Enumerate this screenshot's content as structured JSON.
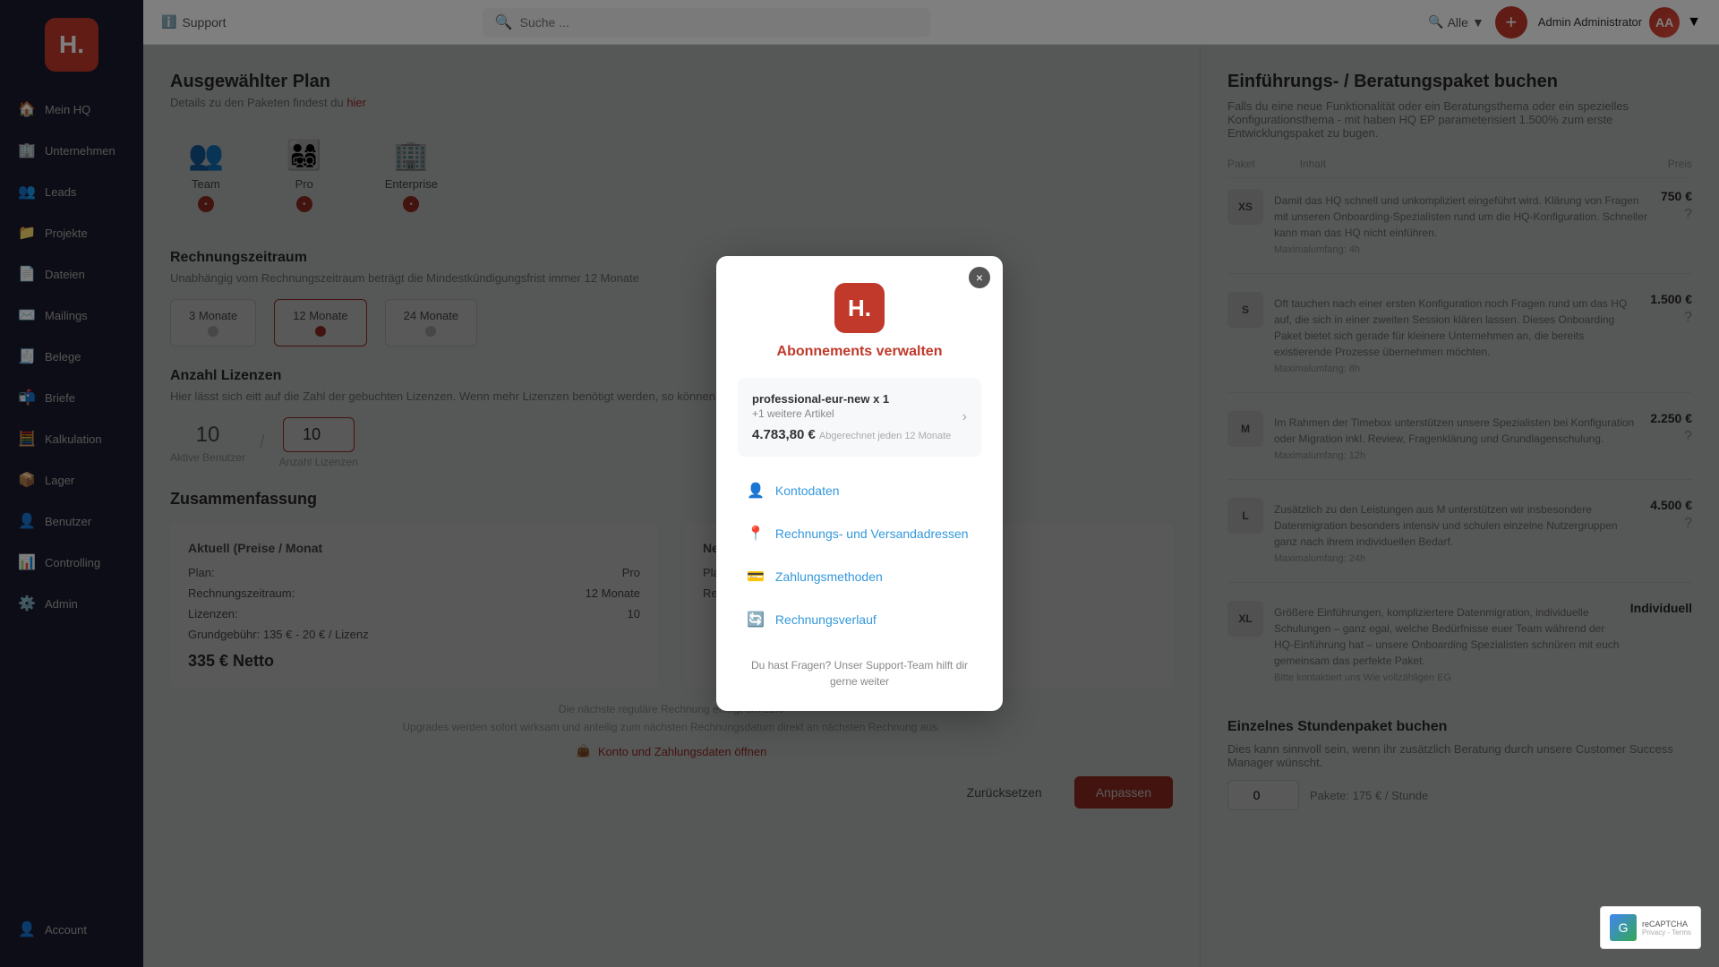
{
  "sidebar": {
    "logo_text": "H.",
    "items": [
      {
        "id": "mein-hq",
        "label": "Mein HQ",
        "icon": "🏠"
      },
      {
        "id": "unternehmen",
        "label": "Unternehmen",
        "icon": "🏢"
      },
      {
        "id": "leads",
        "label": "Leads",
        "icon": "👥"
      },
      {
        "id": "projekte",
        "label": "Projekte",
        "icon": "📁"
      },
      {
        "id": "dateien",
        "label": "Dateien",
        "icon": "📄"
      },
      {
        "id": "mailings",
        "label": "Mailings",
        "icon": "✉️"
      },
      {
        "id": "belege",
        "label": "Belege",
        "icon": "🧾"
      },
      {
        "id": "briefe",
        "label": "Briefe",
        "icon": "📬"
      },
      {
        "id": "kalkulation",
        "label": "Kalkulation",
        "icon": "🧮"
      },
      {
        "id": "lager",
        "label": "Lager",
        "icon": "📦"
      },
      {
        "id": "benutzer",
        "label": "Benutzer",
        "icon": "👤"
      },
      {
        "id": "controlling",
        "label": "Controlling",
        "icon": "📊"
      },
      {
        "id": "admin",
        "label": "Admin",
        "icon": "⚙️"
      }
    ],
    "bottom_items": [
      {
        "id": "account",
        "label": "Account",
        "icon": "👤"
      }
    ]
  },
  "topbar": {
    "support_label": "Support",
    "search_placeholder": "Suche ...",
    "filter_label": "Alle",
    "user_name": "Admin Administrator"
  },
  "left_panel": {
    "title": "Ausgewählter Plan",
    "hint": "Details zu den Paketen findest du",
    "hint_link": "hier",
    "plan_cards": [
      {
        "label": "Team",
        "icon": "👥"
      },
      {
        "label": "Pro",
        "icon": "👨‍👩‍👧‍👦"
      },
      {
        "label": "Enterprise",
        "icon": "🏢"
      }
    ],
    "billing_title": "Rechnungszeitraum",
    "billing_desc": "Unabhängig vom Rechnungszeitraum beträgt die Mindestkündigungsfrist immer 12 Monate",
    "billing_options": [
      {
        "label": "3 Monate"
      },
      {
        "label": "12 Monate"
      },
      {
        "label": "24 Monate"
      }
    ],
    "licenses_title": "Anzahl Lizenzen",
    "licenses_desc": "Hier lässt sich eitt auf die Zahl der gebuchten Lizenzen. Wenn mehr Lizenzen benötigt werden, so können diese",
    "license_current": "10",
    "license_divider": "/",
    "license_new": "10",
    "license_active_label": "Aktive Benutzer",
    "license_count_label": "Anzahl Lizenzen",
    "summary_title": "Zusammenfassung",
    "summary_current_col": "Aktuell (Preise / Monat",
    "summary_new_col": "Neu (Preise / Mono",
    "summary_rows_current": [
      {
        "label": "Plan:",
        "value": "Pro"
      },
      {
        "label": "Rechnungszeitraum:",
        "value": "12 Monate"
      },
      {
        "label": "Lizenzen:",
        "value": "10"
      },
      {
        "label": "Grundgebühr: 135 € - 20 € / Lizenz",
        "value": ""
      }
    ],
    "summary_total_current": "335 € Netto",
    "footer_note": "Die nächste reguläre Rechnung erfolgt am 22.0",
    "footer_note2": "Upgrades werden sofort wirksam und anteilig zum nächsten Rechnungsdatum direkt an nächsten Rechnung aus.",
    "footer_link": "Konto und Zahlungsdaten öffnen",
    "btn_reset": "Zurücksetzen",
    "btn_apply": "Anpassen"
  },
  "right_panel": {
    "title": "Einführungs- / Beratungspaket buchen",
    "desc": "Falls du eine neue Funktionalität oder ein Beratungsthema oder ein spezielles Konfigurationsthema - mit haben HQ EP parameterisiert 1.500% zum erste Entwicklungspaket zu bugen.",
    "table_headers": [
      "Paket",
      "Inhalt",
      "Preis"
    ],
    "services": [
      {
        "badge": "XS",
        "name": "Damit das HQ schnell und unkompliziert eingeführt wird. Klärung von Fragen mit unseren Onboarding-Spezialisten rund um die HQ-Konfiguration. Schneller kann man das HQ nicht einführen.",
        "max": "Maximalumfang: 4h",
        "price": "750 €"
      },
      {
        "badge": "S",
        "name": "Oft tauchen nach einer ersten Konfiguration noch Fragen rund um das HQ auf, die sich in einer zweiten Session klären lassen. Dieses Onboarding Paket bietet sich gerade für kleinere Unternehmen an, die bereits existierende Prozesse übernehmen möchten.",
        "max": "Maximalumfang: 8h",
        "price": "1.500 €"
      },
      {
        "badge": "M",
        "name": "Im Rahmen der Timebox unterstützen unsere Spezialisten bei Konfiguration oder Migration inkl. Review, Fragenklärung und Grundlagenschulung.",
        "max": "Maximalumfang: 12h",
        "price": "2.250 €"
      },
      {
        "badge": "L",
        "name": "Zusätzlich zu den Leistungen aus M unterstützen wir insbesondere Datenmigration besonders intensiv und schulen einzelne Nutzergruppen ganz nach ihrem individuellen Bedarf.",
        "max": "Maximalumfang: 24h",
        "price": "4.500 €"
      },
      {
        "badge": "XL",
        "name": "Größere Einführungen, kompliziertere Datenmigration, individuelle Schulungen – ganz egal, welche Bedürfnisse euer Team während der HQ-Einführung hat – unsere Onboarding Spezialisten schnüren mit euch gemeinsam das perfekte Paket.",
        "max": "Bitte kontaktiert uns Wie vollzähligen EG",
        "price": "Individuell"
      }
    ],
    "hours_title": "Einzelnes Stundenpaket buchen",
    "hours_desc": "Dies kann sinnvoll sein, wenn ihr zusätzlich Beratung durch unsere Customer Success Manager wünscht.",
    "hours_price": "0",
    "hours_unit": "Pakete: 175 € / Stunde"
  },
  "modal": {
    "logo_text": "H.",
    "title": "Abonnements verwalten",
    "close_label": "×",
    "subscription": {
      "name": "professional-eur-new x 1",
      "more": "+1 weitere Artikel",
      "price": "4.783,80 €",
      "billing": "Abgerechnet jeden 12 Monate"
    },
    "menu_items": [
      {
        "id": "kontodaten",
        "label": "Kontodaten",
        "icon": "👤"
      },
      {
        "id": "rechnungs-versandadressen",
        "label": "Rechnungs- und Versandadressen",
        "icon": "📍"
      },
      {
        "id": "zahlungsmethoden",
        "label": "Zahlungsmethoden",
        "icon": "💳"
      },
      {
        "id": "rechnungsverlauf",
        "label": "Rechnungsverlauf",
        "icon": "🔄"
      }
    ],
    "footer_text": "Du hast Fragen? Unser Support-Team hilft dir gerne weiter"
  }
}
